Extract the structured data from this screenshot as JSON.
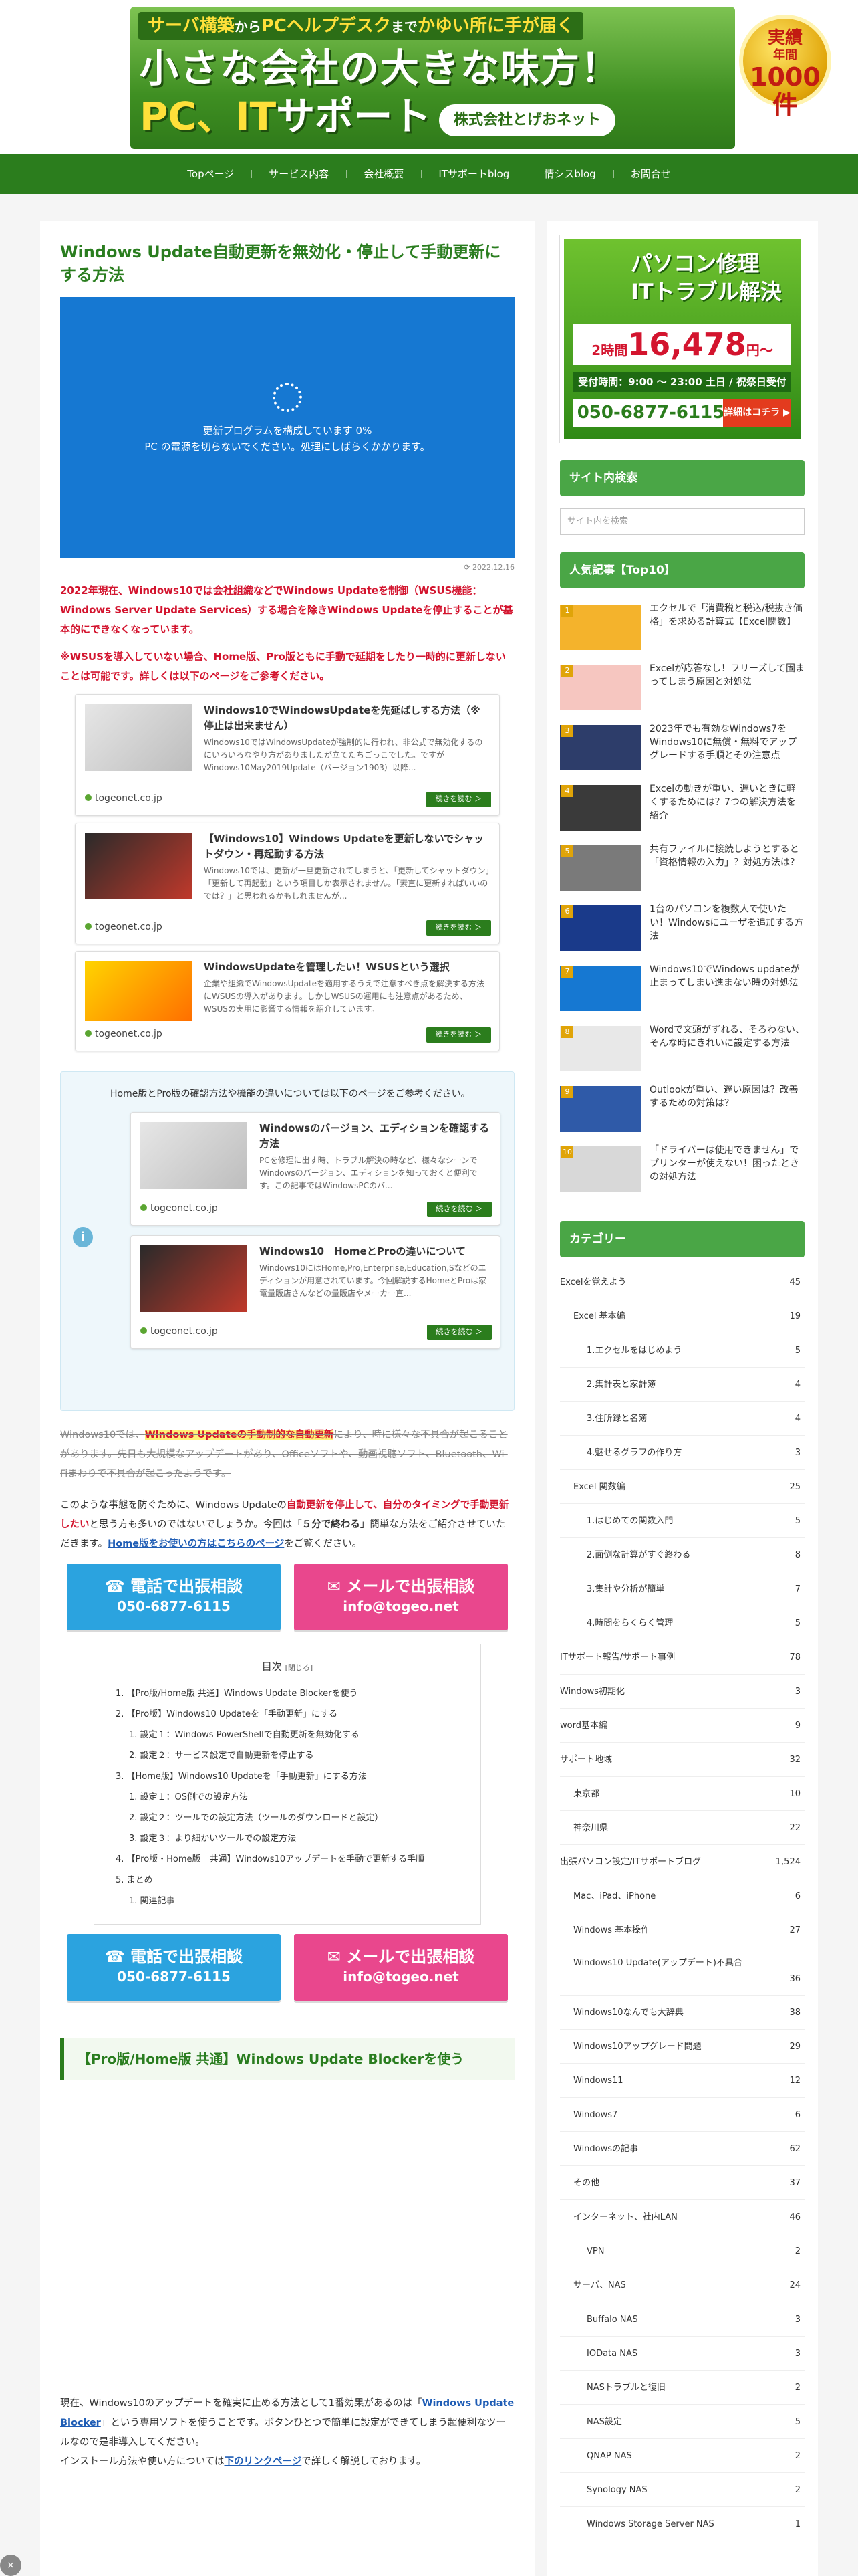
{
  "header": {
    "banner_line1_a": "サーバ構築",
    "banner_line1_b": "から",
    "banner_line1_c": "PCヘルプデスク",
    "banner_line1_d": "まで",
    "banner_line1_e": "かゆい所に手が届く",
    "title_line1": "小さな会社の大きな味方！",
    "title_line2_a": "PC、IT",
    "title_line2_b": "サポート",
    "company": "株式会社とげおネット",
    "medal_a": "実績",
    "medal_b": "年間",
    "medal_c": "1000件"
  },
  "nav": [
    "Topページ",
    "サービス内容",
    "会社概要",
    "ITサポートblog",
    "情シスblog",
    "お問合せ"
  ],
  "article": {
    "title": "Windows Update自動更新を無効化・停止して手動更新にする方法",
    "eyecatch_line1": "更新プログラムを構成しています 0%",
    "eyecatch_line2": "PC の電源を切らないでください。処理にしばらくかかります。",
    "date": "2022.12.16",
    "lead1": "2022年現在、Windows10では会社組織などでWindows Updateを制御（WSUS機能：Windows Server Update Services）する場合を除きWindows Updateを停止することが基本的にできなくなっています。",
    "lead2": "※WSUSを導入していない場合、Home版、Pro版ともに手動で延期をしたり一時的に更新しないことは可能です。詳しくは以下のページをご参考ください。",
    "cards": [
      {
        "title": "Windows10でWindowsUpdateを先延ばしする方法（※停止は出来ません）",
        "desc": "Windows10ではWindowsUpdateが強制的に行われ、非公式で無効化するのにいろいろなやり方がありましたが立てたちごっこでした。ですがWindows10May2019Update（バージョン1903）以降...",
        "domain": "togeonet.co.jp",
        "read": "続きを読む ＞"
      },
      {
        "title": "【Windows10】Windows Updateを更新しないでシャットダウン・再起動する方法",
        "desc": "Windows10では、更新が一旦更新されてしまうと、「更新してシャットダウン」「更新して再起動」という項目しか表示されません。「素直に更新すればいいのでは？」と思われるかもしれませんが...",
        "domain": "togeonet.co.jp",
        "read": "続きを読む ＞"
      },
      {
        "title": "WindowsUpdateを管理したい！WSUSという選択",
        "desc": "企業や組織でWindowsUpdateを適用するうえで注意すべき点を解決する方法にWSUSの導入があります。しかしWSUSの運用にも注意点があるため、WSUSの実用に影響する情報を紹介しています。",
        "domain": "togeonet.co.jp",
        "read": "続きを読む ＞"
      }
    ],
    "info_text": "Home版とPro版の確認方法や機能の違いについては以下のページをご参考ください。",
    "info_cards": [
      {
        "title": "Windowsのバージョン、エディションを確認する方法",
        "desc": "PCを修理に出す時、トラブル解決の時など、様々なシーンでWindowsのバージョン、エディションを知っておくと便利です。この記事ではWindowsPCのバ...",
        "domain": "togeonet.co.jp",
        "read": "続きを読む ＞"
      },
      {
        "title": "Windows10　HomeとProの違いについて",
        "desc": "Windows10にはHome,Pro,Enterprise,Education,Sなどのエディションが用意されています。今回解説するHomeとProは家電量販店さんなどの量販店やメーカー直...",
        "domain": "togeonet.co.jp",
        "read": "続きを読む ＞"
      }
    ],
    "strike_a": "Windows10では、",
    "strike_mark": "Windows Updateの手動制的な自動更新",
    "strike_b": "により、時に様々な不具合が起こることがあります。先日も大規模なアップデートがあり、Officeソフトや、動画視聴ソフト、Bluetooth、Wi-Fiまわりで不具合が起こったようです。",
    "p1_a": "このような事態を防ぐために、Windows Updateの",
    "p1_red": "自動更新を停止して、自分のタイミングで手動更新したい",
    "p1_b": "と思う方も多いのではないでしょうか。今回は「",
    "p1_bold": "５分で終わる",
    "p1_c": "」簡単な方法をご紹介させていただきます。",
    "p1_link": "Home版をお使いの方はこちらのページ",
    "p1_d": "をご覧ください。",
    "btn_tel_a": " 電話で出張相談",
    "btn_tel_b": "050-6877-6115",
    "btn_mail_a": " メールで出張相談",
    "btn_mail_b": "info@togeo.net",
    "toc_title": "目次",
    "toc_close": "[閉じる]",
    "toc": [
      {
        "lv": 1,
        "t": "1. 【Pro版/Home版 共通】Windows Update Blockerを使う"
      },
      {
        "lv": 1,
        "t": "2. 【Pro版】Windows10 Updateを「手動更新」にする"
      },
      {
        "lv": 2,
        "t": "1. 設定１：Windows PowerShellで自動更新を無効化する"
      },
      {
        "lv": 2,
        "t": "2. 設定２：サービス設定で自動更新を停止する"
      },
      {
        "lv": 1,
        "t": "3. 【Home版】Windows10 Updateを「手動更新」にする方法"
      },
      {
        "lv": 2,
        "t": "1. 設定１：OS側での設定方法"
      },
      {
        "lv": 2,
        "t": "2. 設定２：ツールでの設定方法（ツールのダウンロードと設定）"
      },
      {
        "lv": 2,
        "t": "3. 設定３：より細かいツールでの設定方法"
      },
      {
        "lv": 1,
        "t": "4. 【Pro版・Home版　共通】Windows10アップデートを手動で更新する手順"
      },
      {
        "lv": 1,
        "t": "5. まとめ"
      },
      {
        "lv": 2,
        "t": "1. 関連記事"
      }
    ],
    "h2_1": "【Pro版/Home版 共通】Windows Update Blockerを使う",
    "bottom_a": "現在、Windows10のアップデートを確実に止める方法として1番効果があるのは「",
    "bottom_link": "Windows Update Blocker",
    "bottom_b": "」という専用ソフトを使うことです。ボタンひとつで簡単に設定ができてしまう超便利なツールなので是非導入してください。",
    "bottom_c": "インストール方法や使い方については",
    "bottom_link2": "下のリンクページ",
    "bottom_d": "で詳しく解説しております。"
  },
  "sidebar": {
    "ad_t1": "パソコン修理",
    "ad_t2": "ITトラブル解決",
    "ad_price_a": "2時間",
    "ad_price": "16,478",
    "ad_price_b": "円〜",
    "ad_hours": "受付時間：9:00 〜 23:00 土日 / 祝祭日受付",
    "ad_phone": "050-6877-6115",
    "ad_detail": "詳細はコチラ ▶",
    "search_title": "サイト内検索",
    "search_placeholder": "サイト内を検索",
    "popular_title": "人気記事【Top10】",
    "popular": [
      {
        "n": "1",
        "t": "エクセルで「消費税と税込/税抜き価格」を求める計算式【Excel関数】",
        "c": "#f4b32c"
      },
      {
        "n": "2",
        "t": "Excelが応答なし！フリーズして固まってしまう原因と対処法",
        "c": "#f6c6c0"
      },
      {
        "n": "3",
        "t": "2023年でも有効なWindows7をWindows10に無償・無料でアップグレードする手順とその注意点",
        "c": "#2d3d6a"
      },
      {
        "n": "4",
        "t": "Excelの動きが重い、遅いときに軽くするためには？7つの解決方法を紹介",
        "c": "#3a3a3a"
      },
      {
        "n": "5",
        "t": "共有ファイルに接続しようとすると「資格情報の入力」？対処方法は？",
        "c": "#7a7a7a"
      },
      {
        "n": "6",
        "t": "1台のパソコンを複数人で使いたい！Windowsにユーザを追加する方法",
        "c": "#1a3a8a"
      },
      {
        "n": "7",
        "t": "Windows10でWindows updateが止まってしまい進まない時の対処法",
        "c": "#1678d2"
      },
      {
        "n": "8",
        "t": "Wordで文頭がずれる、そろわない、そんな時にきれいに設定する方法",
        "c": "#e8e8e8"
      },
      {
        "n": "9",
        "t": "Outlookが重い、遅い原因は？改善するための対策は？",
        "c": "#2f5aa8"
      },
      {
        "n": "10",
        "t": "「ドライバーは使用できません」でプリンターが使えない！困ったときの対処方法",
        "c": "#d8d8d8"
      }
    ],
    "category_title": "カテゴリー",
    "categories": [
      {
        "d": 1,
        "n": "Excelを覚えよう",
        "c": "45"
      },
      {
        "d": 2,
        "n": "Excel 基本編",
        "c": "19"
      },
      {
        "d": 3,
        "n": "1.エクセルをはじめよう",
        "c": "5"
      },
      {
        "d": 3,
        "n": "2.集計表と家計簿",
        "c": "4"
      },
      {
        "d": 3,
        "n": "3.住所録と名簿",
        "c": "4"
      },
      {
        "d": 3,
        "n": "4.魅せるグラフの作り方",
        "c": "3"
      },
      {
        "d": 2,
        "n": "Excel 関数編",
        "c": "25"
      },
      {
        "d": 3,
        "n": "1.はじめての関数入門",
        "c": "5"
      },
      {
        "d": 3,
        "n": "2.面倒な計算がすぐ終わる",
        "c": "8"
      },
      {
        "d": 3,
        "n": "3.集計や分析が簡単",
        "c": "7"
      },
      {
        "d": 3,
        "n": "4.時間をらくらく管理",
        "c": "5"
      },
      {
        "d": 1,
        "n": "ITサポート報告/サポート事例",
        "c": "78"
      },
      {
        "d": 1,
        "n": "Windows初期化",
        "c": "3"
      },
      {
        "d": 1,
        "n": "word基本編",
        "c": "9"
      },
      {
        "d": 1,
        "n": "サポート地域",
        "c": "32"
      },
      {
        "d": 2,
        "n": "東京都",
        "c": "10"
      },
      {
        "d": 2,
        "n": "神奈川県",
        "c": "22"
      },
      {
        "d": 1,
        "n": "出張パソコン設定/ITサポートブログ",
        "c": "1,524"
      },
      {
        "d": 2,
        "n": "Mac、iPad、iPhone",
        "c": "6"
      },
      {
        "d": 2,
        "n": "Windows 基本操作",
        "c": "27"
      },
      {
        "d": 2,
        "n": "Windows10 Update(アップデート)不具合",
        "c": "36",
        "tall": true
      },
      {
        "d": 2,
        "n": "Windows10なんでも大辞典",
        "c": "38"
      },
      {
        "d": 2,
        "n": "Windows10アップグレード問題",
        "c": "29"
      },
      {
        "d": 2,
        "n": "Windows11",
        "c": "12"
      },
      {
        "d": 2,
        "n": "Windows7",
        "c": "6"
      },
      {
        "d": 2,
        "n": "Windowsの記事",
        "c": "62"
      },
      {
        "d": 2,
        "n": "その他",
        "c": "37"
      },
      {
        "d": 2,
        "n": "インターネット、社内LAN",
        "c": "46"
      },
      {
        "d": 3,
        "n": "VPN",
        "c": "2"
      },
      {
        "d": 2,
        "n": "サーバ、NAS",
        "c": "24"
      },
      {
        "d": 3,
        "n": "Buffalo NAS",
        "c": "3"
      },
      {
        "d": 3,
        "n": "IOData NAS",
        "c": "3"
      },
      {
        "d": 3,
        "n": "NASトラブルと復旧",
        "c": "2"
      },
      {
        "d": 3,
        "n": "NAS設定",
        "c": "5"
      },
      {
        "d": 3,
        "n": "QNAP NAS",
        "c": "2"
      },
      {
        "d": 3,
        "n": "Synology NAS",
        "c": "2"
      },
      {
        "d": 3,
        "n": "Windows Storage Server NAS",
        "c": "1"
      }
    ]
  },
  "totop": "×"
}
